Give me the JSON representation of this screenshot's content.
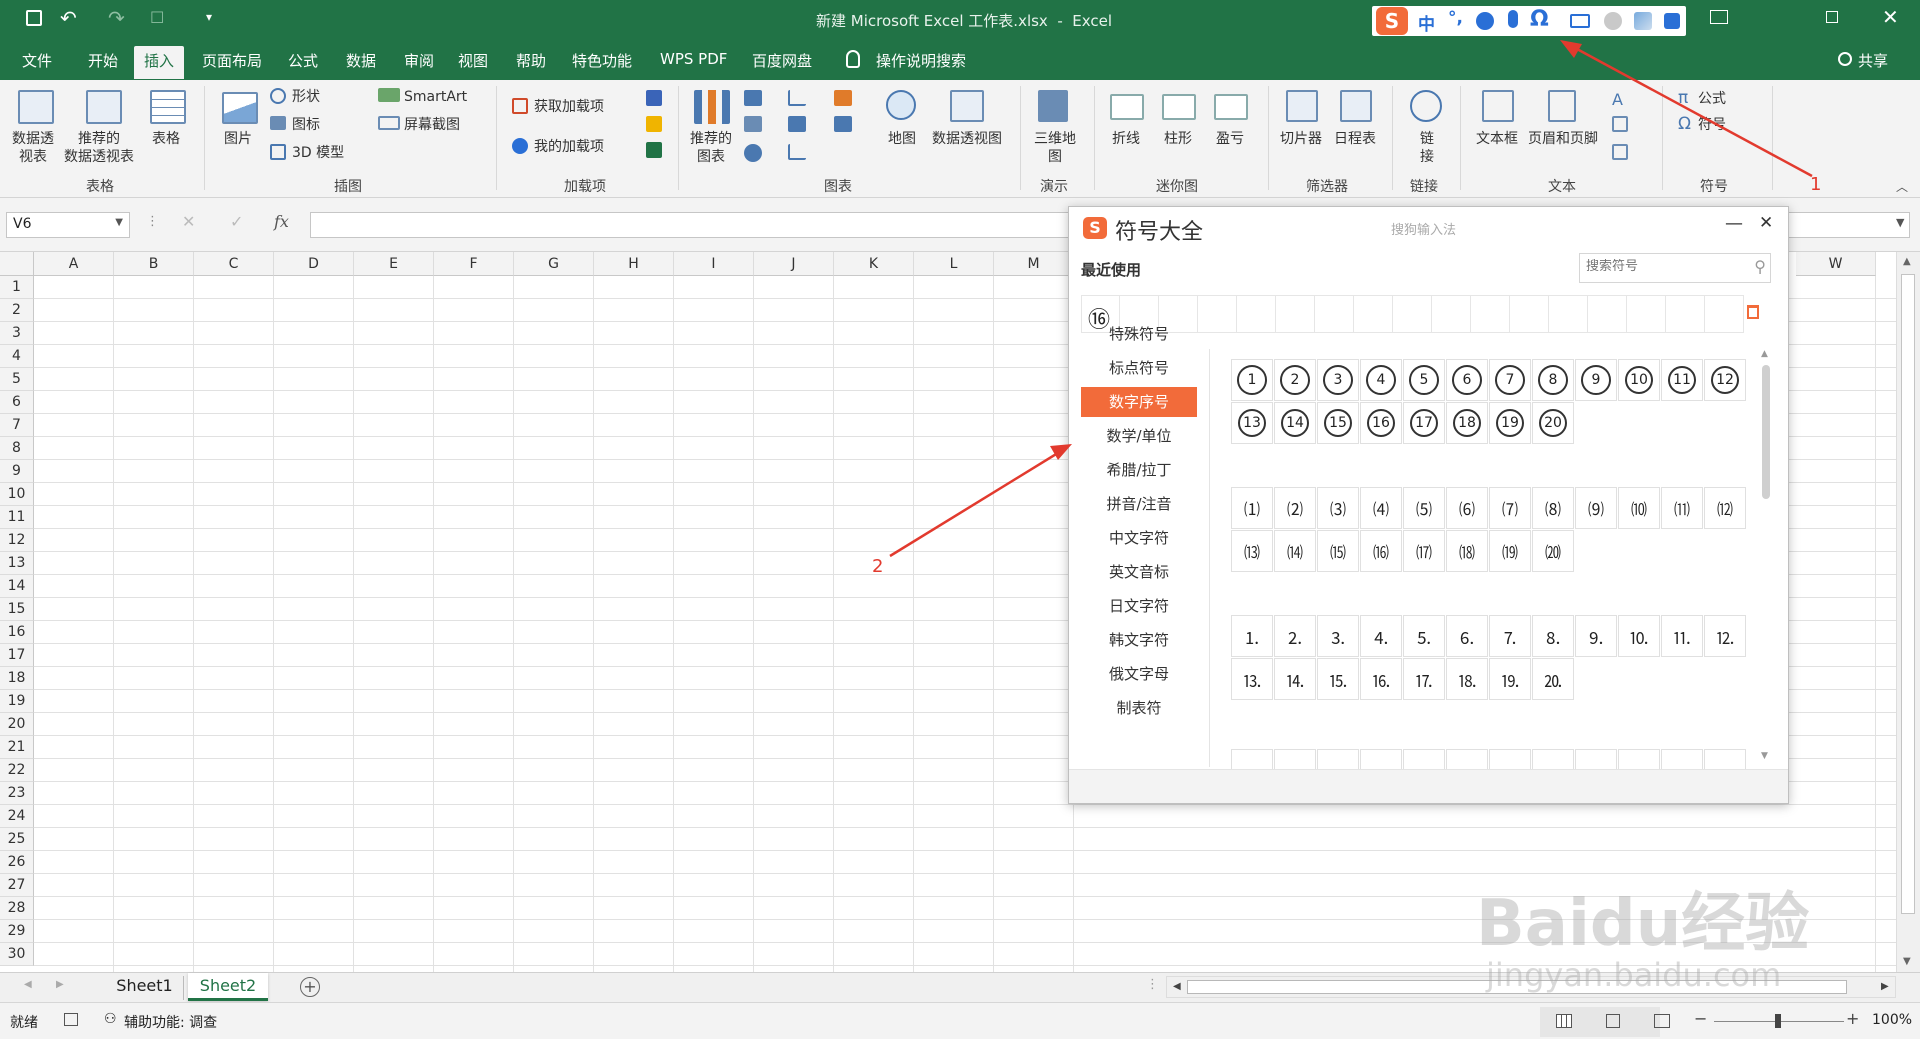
{
  "window": {
    "title": "新建 Microsoft Excel 工作表.xlsx  -  Excel"
  },
  "colors": {
    "excel_green": "#217346",
    "accent": "#f26b3a",
    "annotation": "#e23a2e"
  },
  "tabs": [
    "文件",
    "开始",
    "插入",
    "页面布局",
    "公式",
    "数据",
    "审阅",
    "视图",
    "帮助",
    "特色功能",
    "WPS PDF",
    "百度网盘",
    "操作说明搜索"
  ],
  "share": "共享",
  "ribbon": {
    "g_table": {
      "items": [
        "数据透\n视表",
        "推荐的\n数据透视表",
        "表格"
      ],
      "label": "表格"
    },
    "g_illus": {
      "picture": "图片",
      "shapes": "形状",
      "icons": "图标",
      "model3d": "3D 模型",
      "smartart": "SmartArt",
      "screenshot": "屏幕截图",
      "label": "插图"
    },
    "g_addin": {
      "get": "获取加载项",
      "mine": "我的加载项",
      "label": "加载项"
    },
    "g_chart": {
      "recommended": "推荐的\n图表",
      "map": "地图",
      "pivotchart": "数据透视图",
      "label": "图表"
    },
    "g_tour": {
      "map3d": "三维地\n图",
      "label": "演示"
    },
    "g_spark": {
      "line": "折线",
      "column": "柱形",
      "winloss": "盈亏",
      "label": "迷你图"
    },
    "g_filter": {
      "slicer": "切片器",
      "timeline": "日程表",
      "label": "筛选器"
    },
    "g_link": {
      "link": "链\n接",
      "label": "链接"
    },
    "g_text": {
      "textbox": "文本框",
      "header": "页眉和页脚",
      "label": "文本"
    },
    "g_symbol": {
      "equation": "公式",
      "symbol": "符号",
      "label": "符号"
    }
  },
  "formula_bar": {
    "namebox": "V6",
    "fx": "fx"
  },
  "columns": [
    "A",
    "B",
    "C",
    "D",
    "E",
    "F",
    "G",
    "H",
    "I",
    "J",
    "K",
    "L",
    "M",
    "W"
  ],
  "rows": [
    "1",
    "2",
    "3",
    "4",
    "5",
    "6",
    "7",
    "8",
    "9",
    "10",
    "11",
    "12",
    "13",
    "14",
    "15",
    "16",
    "17",
    "18",
    "19",
    "20",
    "21",
    "22",
    "23",
    "24",
    "25",
    "26",
    "27",
    "28",
    "29",
    "30"
  ],
  "sheets": [
    "Sheet1",
    "Sheet2"
  ],
  "status": {
    "ready": "就绪",
    "accessibility": "辅助功能: 调查",
    "zoom": "100%"
  },
  "ime_bar": {
    "lang": "中"
  },
  "dialog": {
    "title": "符号大全",
    "brand": "搜狗输入法",
    "recent_label": "最近使用",
    "search_placeholder": "搜索符号",
    "recent": [
      "⑯"
    ],
    "categories": [
      "特殊符号",
      "标点符号",
      "数字序号",
      "数学/单位",
      "希腊/拉丁",
      "拼音/注音",
      "中文字符",
      "英文音标",
      "日文字符",
      "韩文字符",
      "俄文字母",
      "制表符"
    ],
    "active_category": "数字序号",
    "circled": [
      "1",
      "2",
      "3",
      "4",
      "5",
      "6",
      "7",
      "8",
      "9",
      "10",
      "11",
      "12",
      "13",
      "14",
      "15",
      "16",
      "17",
      "18",
      "19",
      "20"
    ],
    "parenthesized": [
      "⑴",
      "⑵",
      "⑶",
      "⑷",
      "⑸",
      "⑹",
      "⑺",
      "⑻",
      "⑼",
      "⑽",
      "⑾",
      "⑿",
      "⒀",
      "⒁",
      "⒂",
      "⒃",
      "⒄",
      "⒅",
      "⒆",
      "⒇"
    ],
    "period": [
      "⒈",
      "⒉",
      "⒊",
      "⒋",
      "⒌",
      "⒍",
      "⒎",
      "⒏",
      "⒐",
      "⒑",
      "⒒",
      "⒓",
      "⒔",
      "⒕",
      "⒖",
      "⒗",
      "⒘",
      "⒙",
      "⒚",
      "⒛"
    ]
  },
  "annotations": {
    "a1": "1",
    "a2": "2"
  },
  "watermark": {
    "text": "Baidu经验",
    "url": "jingyan.baidu.com"
  }
}
